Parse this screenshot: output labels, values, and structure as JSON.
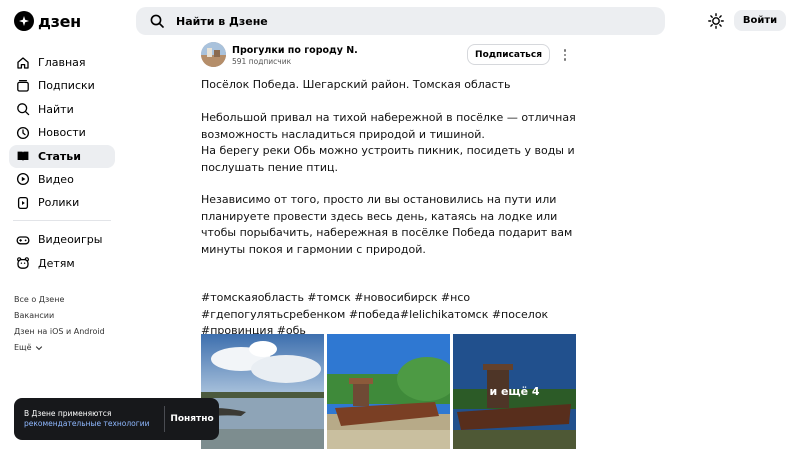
{
  "header": {
    "logo_text": "дзен",
    "search_placeholder": "Найти в Дзене",
    "login_label": "Войти"
  },
  "sidebar": {
    "items": [
      {
        "label": "Главная",
        "icon": "home-icon"
      },
      {
        "label": "Подписки",
        "icon": "subscriptions-icon"
      },
      {
        "label": "Найти",
        "icon": "search-icon"
      },
      {
        "label": "Новости",
        "icon": "news-icon"
      },
      {
        "label": "Статьи",
        "icon": "articles-icon",
        "active": true
      },
      {
        "label": "Видео",
        "icon": "video-icon"
      },
      {
        "label": "Ролики",
        "icon": "clips-icon"
      }
    ],
    "extra": [
      {
        "label": "Видеоигры",
        "icon": "gamepad-icon"
      },
      {
        "label": "Детям",
        "icon": "kids-icon"
      }
    ],
    "footer_links": [
      "Все о Дзене",
      "Вакансии",
      "Дзен на iOS и Android",
      "Ещё"
    ]
  },
  "article": {
    "author_name": "Прогулки по городу N.",
    "author_subs": "591 подписчик",
    "subscribe_label": "Подписаться",
    "paragraphs": [
      "Посёлок Победа. Шегарский район. Томская область",
      "Небольшой привал на тихой набережной в посёлке — отличная возможность насладиться природой и тишиной.",
      "На берегу реки Обь можно устроить пикник, посидеть у воды и послушать пение птиц.",
      "Независимо от того, просто ли вы остановились на пути или планируете провести здесь весь день, катаясь на лодке или чтобы порыбачить, набережная в посёлке Победа подарит вам минуты покоя и гармонии с природой.",
      "#томскаяобласть #томск #новосибирск #нсо #гдепогулятьсребенком #победа#lelichikатомск #поселок #провинция #обь"
    ],
    "more_photos_label": "и ещё 4"
  },
  "cookie": {
    "text": "В Дзене применяются",
    "link": "рекомендательные технологии",
    "button": "Понятно"
  }
}
